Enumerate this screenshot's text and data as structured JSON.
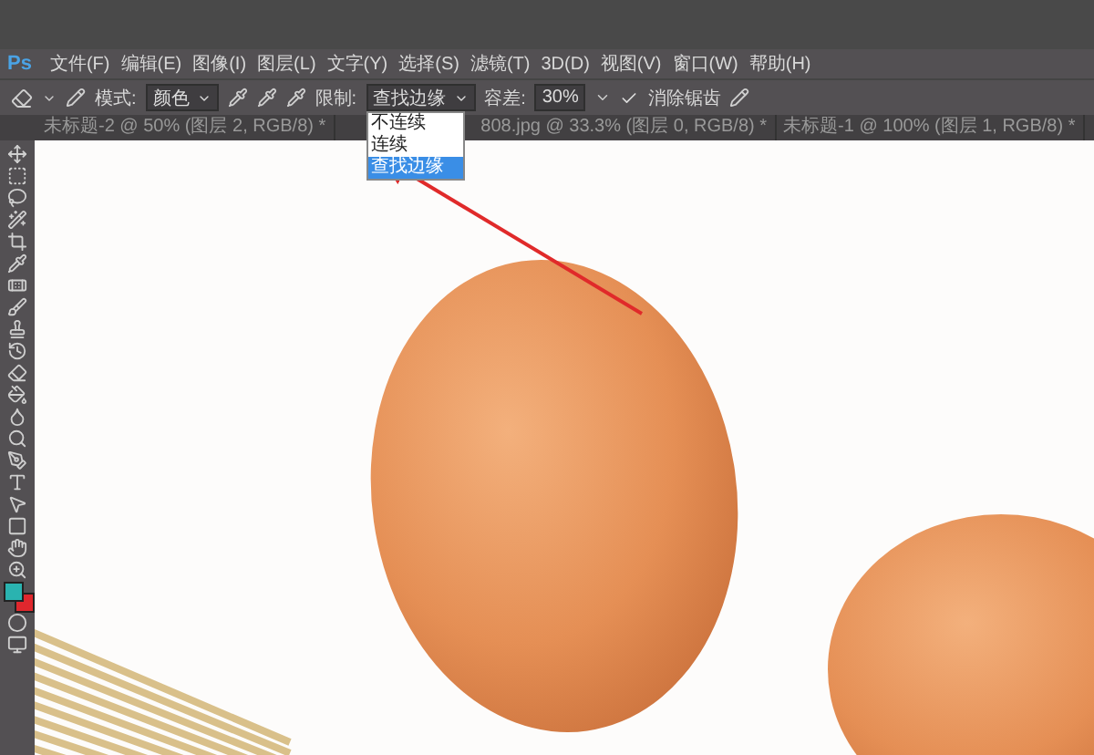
{
  "app": {
    "logo": "Ps"
  },
  "menu": [
    "文件(F)",
    "编辑(E)",
    "图像(I)",
    "图层(L)",
    "文字(Y)",
    "选择(S)",
    "滤镜(T)",
    "3D(D)",
    "视图(V)",
    "窗口(W)",
    "帮助(H)"
  ],
  "options": {
    "mode_label": "模式:",
    "mode_value": "颜色",
    "limit_label": "限制:",
    "limit_value": "查找边缘",
    "limit_options": [
      {
        "label": "不连续",
        "selected": false
      },
      {
        "label": "连续",
        "selected": false
      },
      {
        "label": "查找边缘",
        "selected": true
      }
    ],
    "limit_open": true,
    "tolerance_label": "容差:",
    "tolerance_value": "30%",
    "antialias": {
      "label": "消除锯齿",
      "checked": true
    }
  },
  "tabs": [
    {
      "label": "未标题-2 @ 50% (图层 2, RGB/8) *",
      "selected": false
    },
    {
      "label": "808.jpg @ 33.3% (图层 0, RGB/8) *",
      "selected": false
    },
    {
      "label": "未标题-1 @ 100% (图层 1, RGB/8) *",
      "selected": false
    }
  ]
}
